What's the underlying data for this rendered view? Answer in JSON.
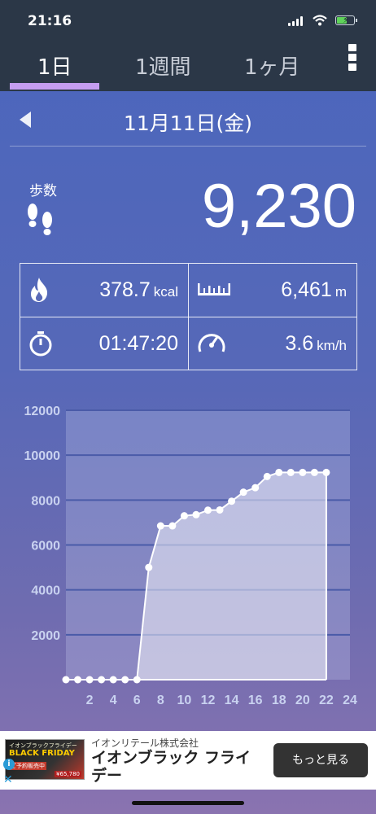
{
  "status": {
    "time": "21:16"
  },
  "tabs": [
    {
      "label": "1日",
      "active": true
    },
    {
      "label": "1週間",
      "active": false
    },
    {
      "label": "1ヶ月",
      "active": false
    }
  ],
  "date": "11月11日(金)",
  "steps": {
    "label": "歩数",
    "value": "9,230"
  },
  "metrics": {
    "calories": {
      "value": "378.7",
      "unit": "kcal",
      "icon": "flame-icon"
    },
    "distance": {
      "value": "6,461",
      "unit": "m",
      "icon": "ruler-icon"
    },
    "duration": {
      "value": "01:47:20",
      "icon": "stopwatch-icon"
    },
    "speed": {
      "value": "3.6",
      "unit": "km/h",
      "icon": "speedometer-icon"
    }
  },
  "chart_data": {
    "type": "area",
    "x": [
      0,
      1,
      2,
      3,
      4,
      5,
      6,
      7,
      8,
      9,
      10,
      11,
      12,
      13,
      14,
      15,
      16,
      17,
      18,
      19,
      20,
      21,
      22
    ],
    "values": [
      0,
      0,
      0,
      0,
      0,
      0,
      0,
      5000,
      6850,
      6850,
      7300,
      7350,
      7550,
      7560,
      7950,
      8350,
      8550,
      9050,
      9230,
      9230,
      9230,
      9230,
      9230
    ],
    "xticks": [
      "2",
      "4",
      "6",
      "8",
      "10",
      "12",
      "14",
      "16",
      "18",
      "20",
      "22",
      "24"
    ],
    "yticks": [
      "2000",
      "4000",
      "6000",
      "8000",
      "10000",
      "12000"
    ],
    "xlim": [
      0,
      24
    ],
    "ylim": [
      0,
      12000
    ],
    "colors": {
      "grid": "#4a5ba8",
      "line": "#ffffff",
      "tick": "#c9d2f0"
    }
  },
  "ad": {
    "company": "イオンリテール株式会社",
    "title": "イオンブラック フライデー",
    "button": "もっと見る",
    "image_text": {
      "top": "イオンブラックフライデー",
      "main": "BLACK FRIDAY",
      "sub": "ご予約販売中",
      "price": "¥65,780"
    }
  }
}
